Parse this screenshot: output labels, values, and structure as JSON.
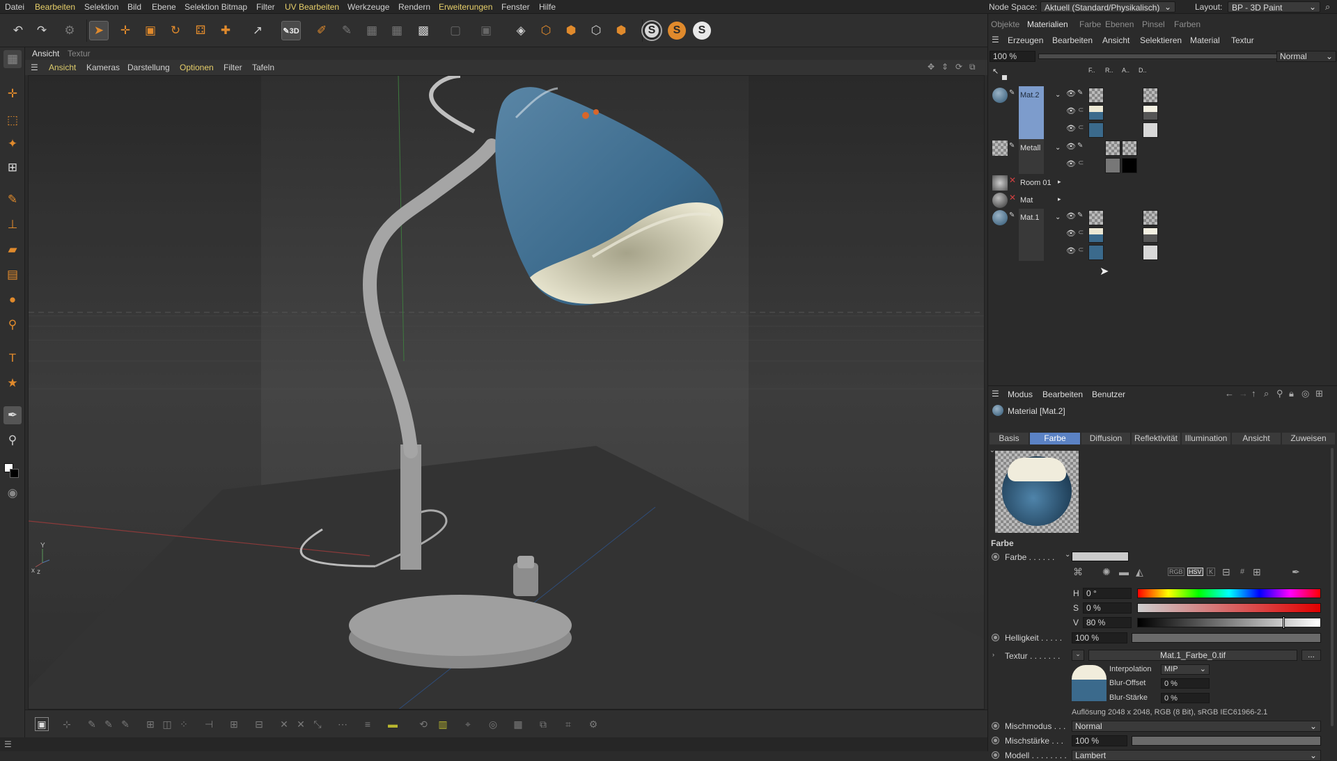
{
  "menu": [
    "Datei",
    "Bearbeiten",
    "Selektion",
    "Bild",
    "Ebene",
    "Selektion Bitmap",
    "Filter",
    "UV Bearbeiten",
    "Werkzeuge",
    "Rendern",
    "Erweiterungen",
    "Fenster",
    "Hilfe"
  ],
  "node_space": {
    "label": "Node Space:",
    "value": "Aktuell (Standard/Physikalisch)"
  },
  "layout": {
    "label": "Layout:",
    "value": "BP - 3D Paint"
  },
  "toolbar": {
    "s_labels": [
      "S",
      "S",
      "S"
    ]
  },
  "viewport": {
    "tabs": [
      "Ansicht",
      "Textur"
    ],
    "menu": [
      "Ansicht",
      "Kameras",
      "Darstellung",
      "Optionen",
      "Filter",
      "Tafeln"
    ],
    "axis_labels": {
      "y": "Y",
      "x": "x",
      "z": "z"
    }
  },
  "right_tabs": [
    "Objekte",
    "Materialien",
    "Farbe",
    "Ebenen",
    "Pinsel",
    "Farben"
  ],
  "material_menu": [
    "Erzeugen",
    "Bearbeiten",
    "Ansicht",
    "Selektieren",
    "Material",
    "Textur"
  ],
  "zoom": {
    "value": "100 %",
    "blend": "Normal"
  },
  "channel_headers": [
    "F..",
    "R..",
    "A..",
    "D.."
  ],
  "materials": [
    {
      "name": "Mat.2",
      "selected": true
    },
    {
      "name": "Metall",
      "selected": false
    },
    {
      "name": "Room 01",
      "selected": false
    },
    {
      "name": "Mat",
      "selected": false
    },
    {
      "name": "Mat.1",
      "selected": false
    }
  ],
  "attr_menu": [
    "Modus",
    "Bearbeiten",
    "Benutzer"
  ],
  "attr_title": "Material [Mat.2]",
  "attr_tabs": [
    {
      "label": "Basis",
      "active": false
    },
    {
      "label": "Farbe",
      "active": true
    },
    {
      "label": "Diffusion",
      "active": false
    },
    {
      "label": "Reflektivität",
      "active": false
    },
    {
      "label": "Illumination",
      "active": false
    },
    {
      "label": "Ansicht",
      "active": false
    },
    {
      "label": "Zuweisen",
      "active": false
    }
  ],
  "farbe": {
    "section": "Farbe",
    "farbe_label": "Farbe . . . . . .",
    "color_modes": [
      "RGB",
      "HSV",
      "K",
      "#"
    ],
    "h": {
      "label": "H",
      "value": "0 °"
    },
    "s": {
      "label": "S",
      "value": "0 %"
    },
    "v": {
      "label": "V",
      "value": "80 %",
      "level": 0.8
    },
    "helligkeit": {
      "label": "Helligkeit . . . . .",
      "value": "100 %",
      "level": 1.0
    },
    "textur": {
      "label": "Textur . . . . . . .",
      "file": "Mat.1_Farbe_0.tif",
      "more": "..."
    },
    "interpolation": {
      "label": "Interpolation",
      "value": "MIP"
    },
    "blur_offset": {
      "label": "Blur-Offset",
      "value": "0 %"
    },
    "blur_staerke": {
      "label": "Blur-Stärke",
      "value": "0 %"
    },
    "resolution": "Auflösung 2048 x 2048, RGB (8 Bit), sRGB IEC61966-2.1",
    "mischmodus": {
      "label": "Mischmodus . . .",
      "value": "Normal"
    },
    "mischstaerke": {
      "label": "Mischstärke . . .",
      "value": "100 %",
      "level": 1.0
    },
    "modell": {
      "label": "Modell . . . . . . . .",
      "value": "Lambert"
    }
  },
  "colors": {
    "accent": "#e08a2c",
    "selected": "#7d9ccc",
    "tab_active": "#5b82c4",
    "lamp_blue": "#3b6a8c",
    "highlight_menu": "#e7cf6a"
  }
}
